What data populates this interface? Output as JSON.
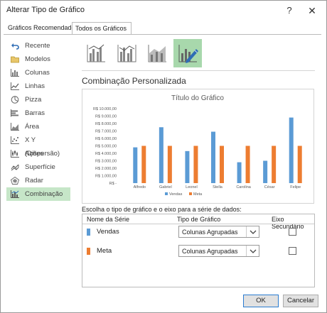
{
  "window": {
    "title": "Alterar Tipo de Gráfico",
    "help": "?",
    "close": "✕"
  },
  "tabs": [
    {
      "label": "Gráficos Recomendados"
    },
    {
      "label": "Todos os Gráficos"
    }
  ],
  "sidebar": {
    "items": [
      {
        "label": "Recente",
        "icon": "undo-icon"
      },
      {
        "label": "Modelos",
        "icon": "folder-icon"
      },
      {
        "label": "Colunas",
        "icon": "column-chart-icon"
      },
      {
        "label": "Linhas",
        "icon": "line-chart-icon"
      },
      {
        "label": "Pizza",
        "icon": "pie-chart-icon"
      },
      {
        "label": "Barras",
        "icon": "bar-chart-icon"
      },
      {
        "label": "Área",
        "icon": "area-chart-icon"
      },
      {
        "label": "X Y (Dispersão)",
        "icon": "scatter-chart-icon"
      },
      {
        "label": "Ações",
        "icon": "stock-chart-icon"
      },
      {
        "label": "Superfície",
        "icon": "surface-chart-icon"
      },
      {
        "label": "Radar",
        "icon": "radar-chart-icon"
      },
      {
        "label": "Combinação",
        "icon": "combo-chart-icon",
        "selected": true
      }
    ]
  },
  "subtypes": [
    {
      "icon": "combo-clustered-line-icon"
    },
    {
      "icon": "combo-clustered-line-secondary-icon"
    },
    {
      "icon": "combo-stacked-area-icon"
    },
    {
      "icon": "custom-combo-icon",
      "selected": true
    }
  ],
  "section": {
    "title": "Combinação Personalizada"
  },
  "chart_data": {
    "type": "bar",
    "title": "Título do Gráfico",
    "categories": [
      "Alfredo",
      "Gabriel",
      "Leonel",
      "Stella",
      "Carolina",
      "César",
      "Felipe"
    ],
    "series": [
      {
        "name": "Vendas",
        "color": "#5b9bd5",
        "values": [
          4800,
          7500,
          4300,
          6900,
          2800,
          3000,
          8800
        ]
      },
      {
        "name": "Meta",
        "color": "#ed7d31",
        "values": [
          5000,
          5000,
          5000,
          5000,
          5000,
          5000,
          5000
        ]
      }
    ],
    "ylim": [
      0,
      10000
    ],
    "yticks": [
      "R$ -",
      "R$ 1.000,00",
      "R$ 2.000,00",
      "R$ 3.000,00",
      "R$ 4.000,00",
      "R$ 5.000,00",
      "R$ 6.000,00",
      "R$ 7.000,00",
      "R$ 8.000,00",
      "R$ 9.000,00",
      "R$ 10.000,00"
    ],
    "legend": "bottom",
    "grid": false
  },
  "series_panel": {
    "title": "Escolha o tipo de gráfico e o eixo para a série de dados:",
    "headers": {
      "name": "Nome da Série",
      "type": "Tipo de Gráfico",
      "axis": "Eixo Secundário"
    },
    "rows": [
      {
        "name": "Vendas",
        "type": "Colunas Agrupadas",
        "color": "#5b9bd5",
        "secondary": false
      },
      {
        "name": "Meta",
        "type": "Colunas Agrupadas",
        "color": "#ed7d31",
        "secondary": false
      }
    ]
  },
  "buttons": {
    "ok": "OK",
    "cancel": "Cancelar"
  }
}
